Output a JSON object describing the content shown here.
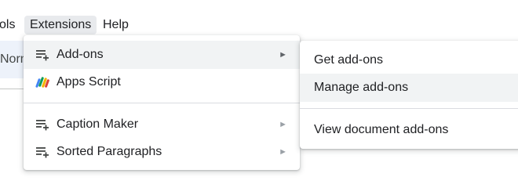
{
  "menubar": {
    "items": [
      {
        "label": "ols"
      },
      {
        "label": "Extensions"
      },
      {
        "label": "Help"
      }
    ]
  },
  "toolbar": {
    "style_value": "Norm"
  },
  "extensions_menu": {
    "items": [
      {
        "label": "Add-ons",
        "icon": "add-list-icon",
        "submenu_arrow": "►"
      },
      {
        "label": "Apps Script",
        "icon": "apps-script-icon"
      },
      {
        "label": "Caption Maker",
        "icon": "add-list-icon",
        "submenu_arrow": "►"
      },
      {
        "label": "Sorted Paragraphs",
        "icon": "add-list-icon",
        "submenu_arrow": "►"
      }
    ]
  },
  "addons_submenu": {
    "items": [
      {
        "label": "Get add-ons"
      },
      {
        "label": "Manage add-ons"
      },
      {
        "label": "View document add-ons"
      }
    ]
  },
  "colors": {
    "hover_background": "#f1f3f4",
    "active_menubar_background": "#e8eaed",
    "toolbar_background": "#edf2fa"
  }
}
